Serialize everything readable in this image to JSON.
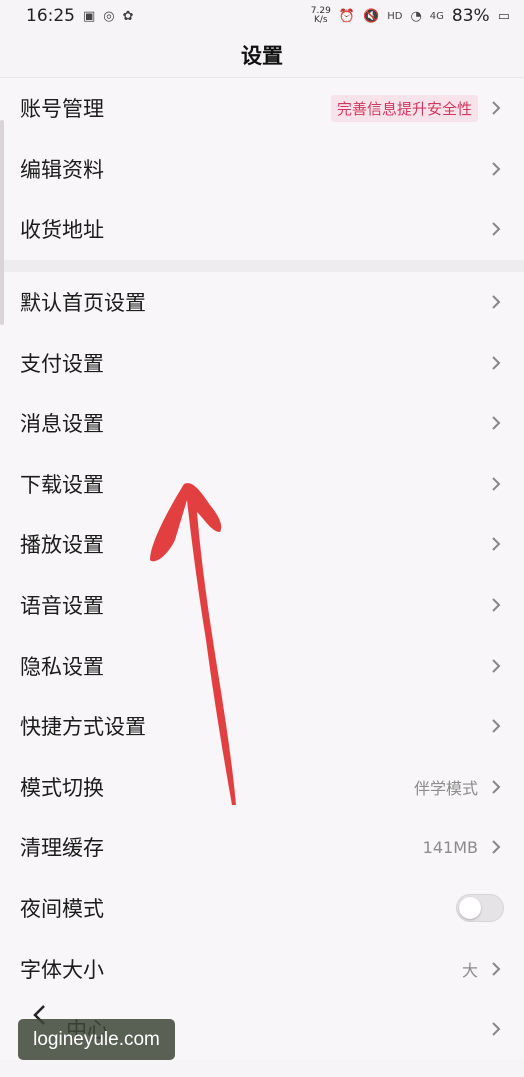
{
  "status": {
    "time": "16:25",
    "net_speed_value": "7.29",
    "net_speed_unit": "K/s",
    "hd": "HD",
    "net_type": "4G",
    "battery": "83%"
  },
  "header": {
    "title": "设置"
  },
  "group1": [
    {
      "label": "账号管理",
      "badge": "完善信息提升安全性"
    },
    {
      "label": "编辑资料"
    },
    {
      "label": "收货地址"
    }
  ],
  "group2": [
    {
      "label": "默认首页设置"
    },
    {
      "label": "支付设置"
    },
    {
      "label": "消息设置"
    },
    {
      "label": "下载设置"
    },
    {
      "label": "播放设置"
    },
    {
      "label": "语音设置"
    },
    {
      "label": "隐私设置"
    },
    {
      "label": "快捷方式设置"
    },
    {
      "label": "模式切换",
      "value": "伴学模式"
    },
    {
      "label": "清理缓存",
      "value": "141MB"
    },
    {
      "label": "夜间模式",
      "toggle": false
    },
    {
      "label": "字体大小",
      "value": "大"
    },
    {
      "label": "中心"
    }
  ],
  "watermark": "logineyule.com",
  "colors": {
    "accent": "#d0385f",
    "badge_bg": "#f9e3ea",
    "arrow": "#e03030"
  }
}
